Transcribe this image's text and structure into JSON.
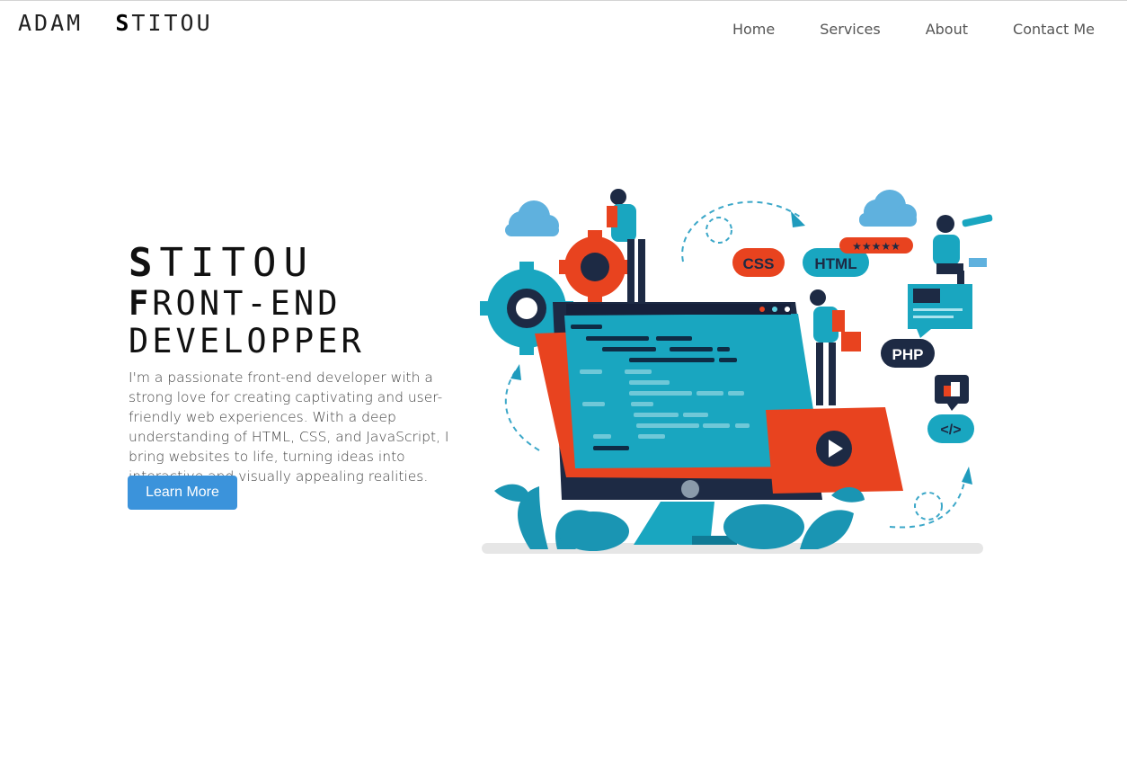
{
  "header": {
    "logo_first": "ADAM",
    "logo_last_initial": "S",
    "logo_last_rest": "TITOU",
    "nav": [
      "Home",
      "Services",
      "About",
      "Contact Me"
    ]
  },
  "hero": {
    "name_initial": "S",
    "name_rest": "TITOU",
    "role_line1_initial": "F",
    "role_line1_rest": "RONT-END",
    "role_line2": "DEVELOPPER",
    "description": "I'm a passionate front-end developer with a strong love for creating captivating and user-friendly web experiences. With a deep understanding of HTML, CSS, and JavaScript, I bring websites to life, turning ideas into interactive and visually appealing realities.",
    "button_label": "Learn More"
  },
  "illustration": {
    "badges": [
      "CSS",
      "HTML",
      "PHP",
      "</>"
    ],
    "colors": {
      "teal": "#19a6c0",
      "orange": "#e8431f",
      "navy": "#1d2a44",
      "button": "#3b93db"
    }
  }
}
